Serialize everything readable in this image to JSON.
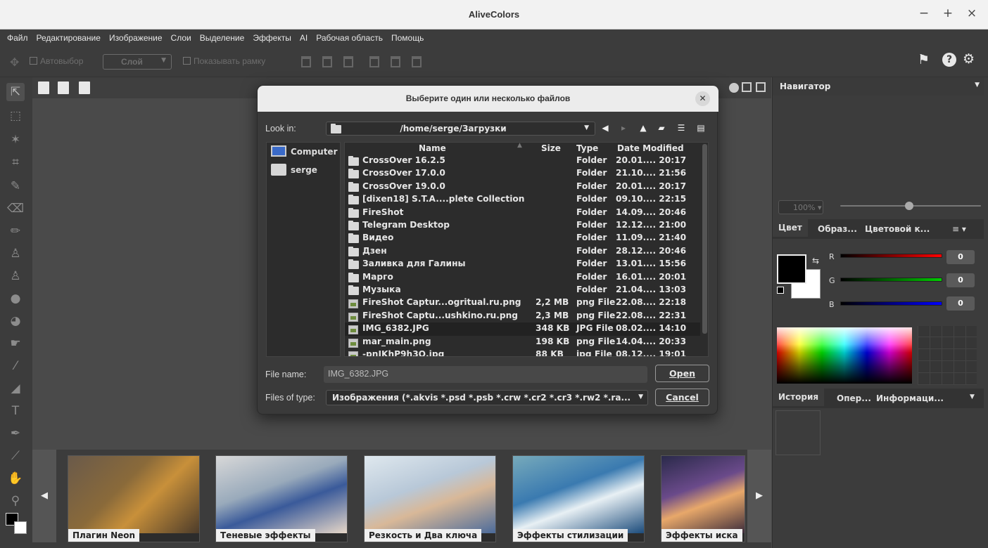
{
  "window": {
    "title": "AliveColors",
    "minimize": "−",
    "maximize": "+",
    "close": "×"
  },
  "menu": [
    "Файл",
    "Редактирование",
    "Изображение",
    "Слои",
    "Выделение",
    "Эффекты",
    "AI",
    "Рабочая область",
    "Помощь"
  ],
  "options": {
    "autoselect": "Автовыбор",
    "layer": "Слой",
    "show_frame": "Показывать рамку"
  },
  "top_right_icons": [
    "feedback-icon",
    "help-icon",
    "settings-icon"
  ],
  "navigator": {
    "title": "Навигатор",
    "zoom": "100%"
  },
  "color_panel": {
    "tabs": [
      "Цвет",
      "Образ...",
      "Цветовой к..."
    ],
    "r_label": "R",
    "g_label": "G",
    "b_label": "B",
    "r": "0",
    "g": "0",
    "b": "0"
  },
  "history_panel": {
    "tabs": [
      "История",
      "Опер...",
      "Информаци..."
    ]
  },
  "thumbnails": [
    "Плагин Neon",
    "Теневые эффекты",
    "Резкость и Два ключа",
    "Эффекты стилизации",
    "Эффекты иска"
  ],
  "dialog": {
    "title": "Выберите один или несколько файлов",
    "look_in_label": "Look in:",
    "look_in_path": "/home/serge/Загрузки",
    "sidebar": [
      "Computer",
      "serge"
    ],
    "columns": {
      "name": "Name",
      "size": "Size",
      "type": "Type",
      "date": "Date Modified"
    },
    "files": [
      {
        "name": "CrossOver 16.2.5",
        "size": "",
        "type": "Folder",
        "date": "20.01.... 20:17",
        "kind": "folder"
      },
      {
        "name": "CrossOver 17.0.0",
        "size": "",
        "type": "Folder",
        "date": "21.10.... 21:56",
        "kind": "folder"
      },
      {
        "name": "CrossOver 19.0.0",
        "size": "",
        "type": "Folder",
        "date": "20.01.... 20:17",
        "kind": "folder"
      },
      {
        "name": "[dixen18] S.T.A....plete Collection",
        "size": "",
        "type": "Folder",
        "date": "09.10.... 22:15",
        "kind": "folder"
      },
      {
        "name": "FireShot",
        "size": "",
        "type": "Folder",
        "date": "14.09.... 20:46",
        "kind": "folder"
      },
      {
        "name": "Telegram Desktop",
        "size": "",
        "type": "Folder",
        "date": "12.12.... 21:00",
        "kind": "folder"
      },
      {
        "name": "Видео",
        "size": "",
        "type": "Folder",
        "date": "11.09.... 21:40",
        "kind": "folder"
      },
      {
        "name": "Дзен",
        "size": "",
        "type": "Folder",
        "date": "28.12.... 20:46",
        "kind": "folder"
      },
      {
        "name": "Заливка для Галины",
        "size": "",
        "type": "Folder",
        "date": "13.01.... 15:56",
        "kind": "folder"
      },
      {
        "name": "Марго",
        "size": "",
        "type": "Folder",
        "date": "16.01.... 20:01",
        "kind": "folder"
      },
      {
        "name": "Музыка",
        "size": "",
        "type": "Folder",
        "date": "21.04.... 13:03",
        "kind": "folder"
      },
      {
        "name": "FireShot Captur...ogritual.ru.png",
        "size": "2,2 MB",
        "type": "png File",
        "date": "22.08.... 22:18",
        "kind": "image"
      },
      {
        "name": "FireShot Captu...ushkino.ru.png",
        "size": "2,3 MB",
        "type": "png File",
        "date": "22.08.... 22:31",
        "kind": "image"
      },
      {
        "name": "IMG_6382.JPG",
        "size": "348 KB",
        "type": "JPG File",
        "date": "08.02.... 14:10",
        "kind": "image",
        "selected": true
      },
      {
        "name": "mar_main.png",
        "size": "198 KB",
        "type": "png File",
        "date": "14.04.... 20:33",
        "kind": "image"
      },
      {
        "name": "-pnIKhP9h3Q.jpg",
        "size": "88 KB",
        "type": "jpg File",
        "date": "08.12.... 19:01",
        "kind": "image"
      }
    ],
    "file_name_label": "File name:",
    "file_name_value": "IMG_6382.JPG",
    "file_type_label": "Files of type:",
    "file_type_value": "Изображения (*.akvis *.psd *.psb *.crw *.cr2 *.cr3 *.rw2 *.ra...",
    "open_label": "Open",
    "cancel_label": "Cancel"
  }
}
